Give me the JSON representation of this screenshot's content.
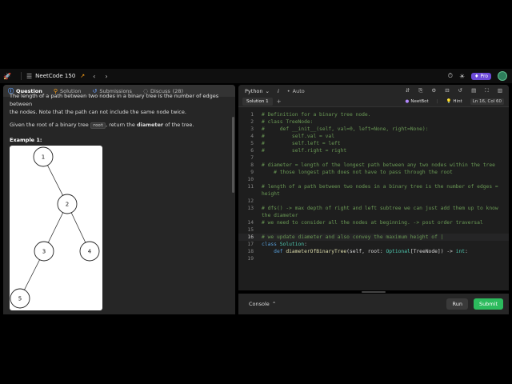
{
  "navbar": {
    "list_name": "NeetCode 150",
    "premium_label": "Pro"
  },
  "left": {
    "tabs": [
      {
        "label": "Question"
      },
      {
        "label": "Solution"
      },
      {
        "label": "Submissions"
      },
      {
        "label": "Discuss",
        "count": "(28)"
      }
    ],
    "desc_cut_line": "The length of a path between two nodes in a binary tree is the number of edges between",
    "desc_line2": "the nodes. Note that the path can not include the same node twice.",
    "desc_para2_pre": "Given the root of a binary tree",
    "desc_para2_code": "root",
    "desc_para2_mid": ", return the",
    "desc_para2_bold": "diameter",
    "desc_para2_post": "of the tree.",
    "example_title": "Example 1:",
    "tree_nodes": [
      "1",
      "2",
      "3",
      "4",
      "5"
    ]
  },
  "editor": {
    "language": "Python",
    "autocomplete": "Auto",
    "subtab": "Solution 1",
    "neetbot": "NeetBot",
    "hint": "Hint",
    "position": "Ln 16, Col 60",
    "lines": [
      {
        "n": "1",
        "text": "# Definition for a binary tree node.",
        "kind": "cmt"
      },
      {
        "n": "2",
        "text": "# class TreeNode:",
        "kind": "cmt"
      },
      {
        "n": "3",
        "text": "#     def __init__(self, val=0, left=None, right=None):",
        "kind": "cmt"
      },
      {
        "n": "4",
        "text": "#         self.val = val",
        "kind": "cmt"
      },
      {
        "n": "5",
        "text": "#         self.left = left",
        "kind": "cmt"
      },
      {
        "n": "6",
        "text": "#         self.right = right",
        "kind": "cmt"
      },
      {
        "n": "7",
        "text": "",
        "kind": "cmt"
      },
      {
        "n": "8",
        "text": "# diameter = length of the longest path between any two nodes within the tree",
        "kind": "cmt"
      },
      {
        "n": "9",
        "text": "    # those longest path does not have to pass through the root",
        "kind": "cmt"
      },
      {
        "n": "10",
        "text": "",
        "kind": "cmt"
      },
      {
        "n": "11",
        "text": "# length of a path between two nodes in a binary tree is the number of edges =",
        "kind": "cmt"
      },
      {
        "n": "",
        "text": "height",
        "kind": "cmt"
      },
      {
        "n": "12",
        "text": "",
        "kind": "cmt"
      },
      {
        "n": "13",
        "text": "# dfs() -> max depth of right and left subtree we can just add them up to know",
        "kind": "cmt"
      },
      {
        "n": "",
        "text": "the diameter",
        "kind": "cmt"
      },
      {
        "n": "14",
        "text": "# we need to consider all the nodes at beginning. -> post order traversal",
        "kind": "cmt"
      },
      {
        "n": "15",
        "text": "",
        "kind": "cmt"
      },
      {
        "n": "16",
        "text": "# we update diameter and also convey the maximum height of |",
        "kind": "cmt"
      },
      {
        "n": "17",
        "text": "",
        "kind": "class"
      },
      {
        "n": "18",
        "text": "",
        "kind": "def"
      },
      {
        "n": "19",
        "text": "",
        "kind": "cmt"
      }
    ],
    "class_kw": "class",
    "class_name": "Solution",
    "def_kw": "def",
    "def_name": "diameterOfBinaryTree",
    "def_params": "(self, root: ",
    "def_type1": "Optional",
    "def_type_inner": "[TreeNode]",
    "def_arrow": ") -> ",
    "def_ret": "int",
    "def_end": ":"
  },
  "console": {
    "label": "Console",
    "run": "Run",
    "submit": "Submit"
  }
}
